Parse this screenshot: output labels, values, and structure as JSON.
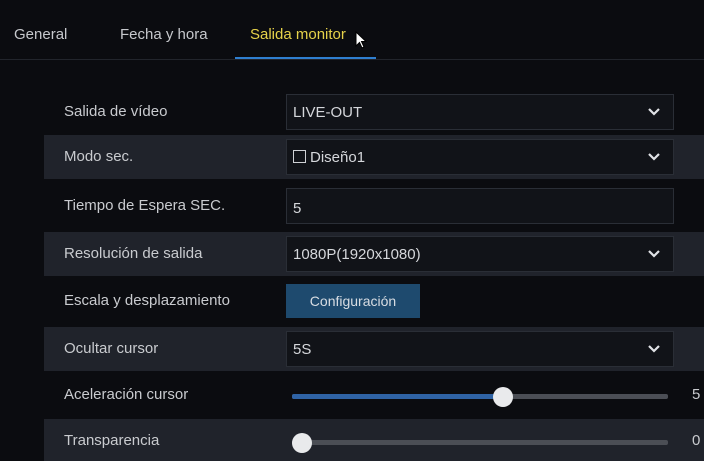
{
  "tabs": [
    {
      "label": "General",
      "active": false
    },
    {
      "label": "Fecha y hora",
      "active": false
    },
    {
      "label": "Salida monitor",
      "active": true
    }
  ],
  "settings": {
    "video_output": {
      "label": "Salida de vídeo",
      "value": "LIVE-OUT"
    },
    "seq_mode": {
      "label": "Modo sec.",
      "value": "Diseño1",
      "checked": false
    },
    "seq_timeout": {
      "label": "Tiempo de Espera SEC.",
      "value": "5"
    },
    "output_resolution": {
      "label": "Resolución de salida",
      "value": "1080P(1920x1080)"
    },
    "scale_offset": {
      "label": "Escala y desplazamiento",
      "button_label": "Configuración"
    },
    "hide_cursor": {
      "label": "Ocultar cursor",
      "value": "5S"
    },
    "cursor_accel": {
      "label": "Aceleración cursor",
      "value": "5",
      "fraction": 0.56
    },
    "transparency": {
      "label": "Transparencia",
      "value": "0",
      "fraction": 0.0
    }
  },
  "icons": {
    "dropdown": "chevron-down-icon",
    "pointer": "mouse-pointer-icon"
  },
  "colors": {
    "accent": "#2f7fd0",
    "active_tab_text": "#e6d24a",
    "button_bg": "#1e4a6e",
    "slider_fill": "#2f63a5"
  }
}
